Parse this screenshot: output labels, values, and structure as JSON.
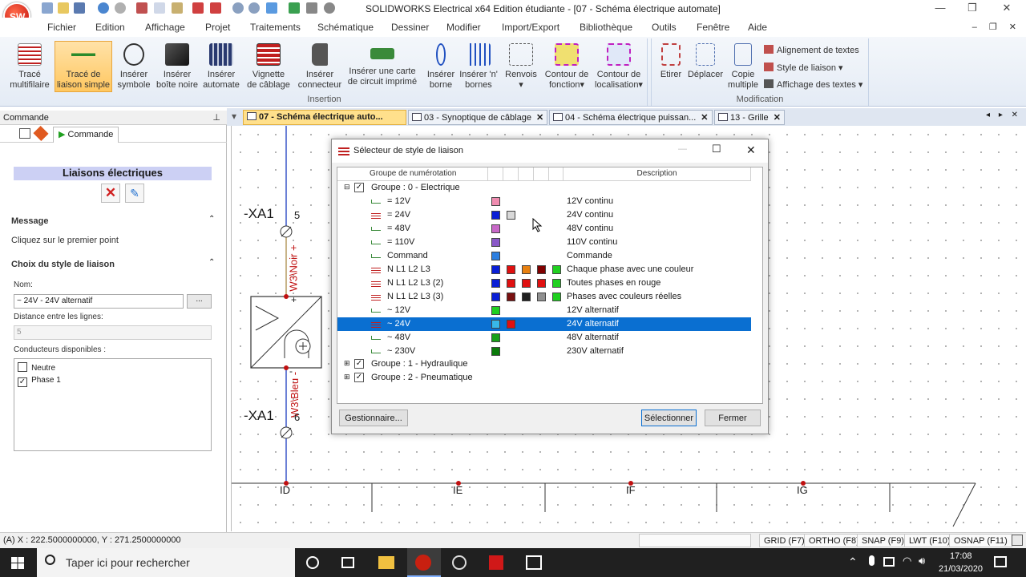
{
  "titlebar": {
    "title": "SOLIDWORKS Electrical x64 Edition étudiante - [07 - Schéma électrique automate]"
  },
  "menu": [
    "Fichier",
    "Edition",
    "Affichage",
    "Projet",
    "Traitements",
    "Schématique",
    "Dessiner",
    "Modifier",
    "Import/Export",
    "Bibliothèque",
    "Outils",
    "Fenêtre",
    "Aide"
  ],
  "menu_active": "Schématique",
  "ribbon": {
    "b1": [
      "Tracé",
      "multifilaire"
    ],
    "b2": [
      "Tracé de",
      "liaison simple"
    ],
    "b3": [
      "Insérer",
      "symbole"
    ],
    "b4": [
      "Insérer",
      "boîte noire"
    ],
    "b5": [
      "Insérer",
      "automate"
    ],
    "b6": [
      "Vignette",
      "de câblage"
    ],
    "b7": [
      "Insérer",
      "connecteur"
    ],
    "b8": [
      "Insérer une carte",
      "de circuit imprimé"
    ],
    "b9": [
      "Insérer",
      "borne"
    ],
    "b10": [
      "Insérer 'n'",
      "bornes"
    ],
    "b11": [
      "Renvois",
      ""
    ],
    "b12": [
      "Contour de",
      "fonction"
    ],
    "b13": [
      "Contour de",
      "localisation"
    ],
    "insertion_label": "Insertion",
    "b14": [
      "Etirer",
      ""
    ],
    "b15": [
      "Déplacer",
      ""
    ],
    "b16": [
      "Copie",
      "multiple"
    ],
    "small1": "Alignement de textes",
    "small2": "Style de liaison",
    "small3": "Affichage des textes",
    "modification_label": "Modification"
  },
  "left": {
    "header": "Commande",
    "tab": "Commande",
    "section_title": "Liaisons électriques",
    "message_label": "Message",
    "message_text": "Cliquez sur le premier point",
    "style_label": "Choix du style de liaison",
    "name_label": "Nom:",
    "name_value": "~ 24V - 24V alternatif",
    "browse": "...",
    "distance_label": "Distance entre les lignes:",
    "distance_value": "5",
    "conductors_label": "Conducteurs disponibles :",
    "conductors": [
      {
        "label": "Neutre",
        "checked": false
      },
      {
        "label": "Phase 1",
        "checked": true
      }
    ]
  },
  "tabs": [
    "07 - Schéma électrique auto...",
    "03 - Synoptique de câblage",
    "04 - Schéma électrique puissan...",
    "13 - Grille"
  ],
  "schematic": {
    "xa1_top": "-XA1",
    "pin5": "5",
    "wire_top": "W3\\Noir +",
    "xa1_bot": "-XA1",
    "pin6": "6",
    "wire_bot": "W3\\Bleu -",
    "plus": "+",
    "minus": "-",
    "bus": [
      "ID",
      "IE",
      "IF",
      "IG"
    ]
  },
  "dialog": {
    "title": "Sélecteur de style de liaison",
    "col1": "Groupe de numérotation",
    "col2": "Description",
    "group0": "Groupe : 0 - Electrique",
    "rows": [
      {
        "name": "= 12V",
        "desc": "12V continu",
        "icon": "single",
        "colors": [
          "#f08cb0"
        ]
      },
      {
        "name": "= 24V",
        "desc": "24V continu",
        "icon": "multi",
        "colors": [
          "#0a1fd6",
          "#d8d8d8"
        ]
      },
      {
        "name": "= 48V",
        "desc": "48V continu",
        "icon": "single",
        "colors": [
          "#c868c8"
        ]
      },
      {
        "name": "= 110V",
        "desc": "110V continu",
        "icon": "single",
        "colors": [
          "#8a58c8"
        ]
      },
      {
        "name": "Command",
        "desc": "Commande",
        "icon": "single",
        "colors": [
          "#2d7fe0"
        ]
      },
      {
        "name": "N L1 L2 L3",
        "desc": "Chaque phase avec une couleur",
        "icon": "multi",
        "colors": [
          "#0a1fd6",
          "#e01010",
          "#e88010",
          "#800000",
          "#20d020"
        ]
      },
      {
        "name": "N L1 L2 L3 (2)",
        "desc": "Toutes phases en rouge",
        "icon": "multi",
        "colors": [
          "#0a1fd6",
          "#e01010",
          "#e01010",
          "#e01010",
          "#20d020"
        ]
      },
      {
        "name": "N L1 L2 L3 (3)",
        "desc": "Phases avec couleurs réelles",
        "icon": "multi",
        "colors": [
          "#0a1fd6",
          "#7a1010",
          "#202020",
          "#909090",
          "#20d020"
        ]
      },
      {
        "name": "~ 12V",
        "desc": "12V alternatif",
        "icon": "single",
        "colors": [
          "#20d020"
        ]
      },
      {
        "name": "~ 24V",
        "desc": "24V alternatif",
        "icon": "multi",
        "colors": [
          "#38b8e8",
          "#e01010"
        ],
        "selected": true
      },
      {
        "name": "~ 48V",
        "desc": "48V alternatif",
        "icon": "single",
        "colors": [
          "#18a018"
        ]
      },
      {
        "name": "~ 230V",
        "desc": "230V alternatif",
        "icon": "single",
        "colors": [
          "#0a7a0a"
        ]
      }
    ],
    "group1": "Groupe : 1 - Hydraulique",
    "group2": "Groupe : 2 - Pneumatique",
    "btn_manager": "Gestionnaire...",
    "btn_select": "Sélectionner",
    "btn_close": "Fermer"
  },
  "status": {
    "coords": "(A) X : 222.5000000000, Y : 271.2500000000",
    "grid": "GRID (F7)",
    "ortho": "ORTHO (F8)",
    "snap": "SNAP (F9)",
    "lwt": "LWT (F10)",
    "osnap": "OSNAP (F11)"
  },
  "taskbar": {
    "search": "Taper ici pour rechercher",
    "time": "17:08",
    "date": "21/03/2020"
  }
}
